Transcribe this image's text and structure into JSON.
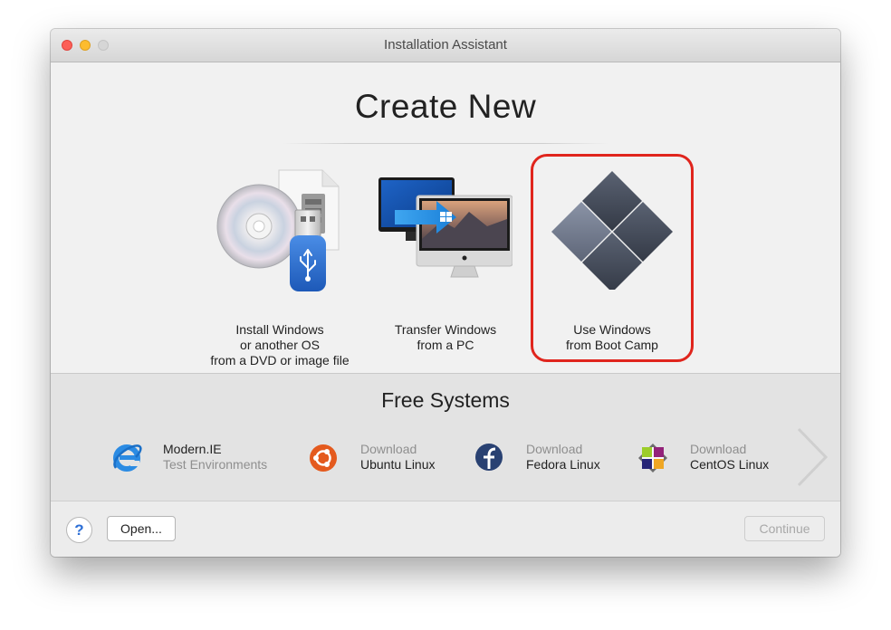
{
  "window": {
    "title": "Installation Assistant"
  },
  "create_new": {
    "title": "Create New",
    "options": [
      {
        "lines": [
          "Install Windows",
          "or another OS",
          "from a DVD or image file"
        ],
        "icon": "dvd-usb-icon"
      },
      {
        "lines": [
          "Transfer Windows",
          "from a PC"
        ],
        "icon": "pc-to-mac-icon"
      },
      {
        "lines": [
          "Use Windows",
          "from Boot Camp"
        ],
        "icon": "boot-camp-icon",
        "highlighted": true
      }
    ]
  },
  "free_systems": {
    "title": "Free Systems",
    "items": [
      {
        "line1": "Modern.IE",
        "line2": "Test Environments",
        "icon": "internet-explorer-icon"
      },
      {
        "line1": "Download",
        "line2": "Ubuntu Linux",
        "icon": "ubuntu-icon"
      },
      {
        "line1": "Download",
        "line2": "Fedora Linux",
        "icon": "fedora-icon"
      },
      {
        "line1": "Download",
        "line2": "CentOS Linux",
        "icon": "centos-icon"
      }
    ]
  },
  "footer": {
    "help_label": "?",
    "open_label": "Open...",
    "continue_label": "Continue"
  },
  "colors": {
    "highlight": "#e0251d",
    "help_blue": "#2d6fd6"
  }
}
